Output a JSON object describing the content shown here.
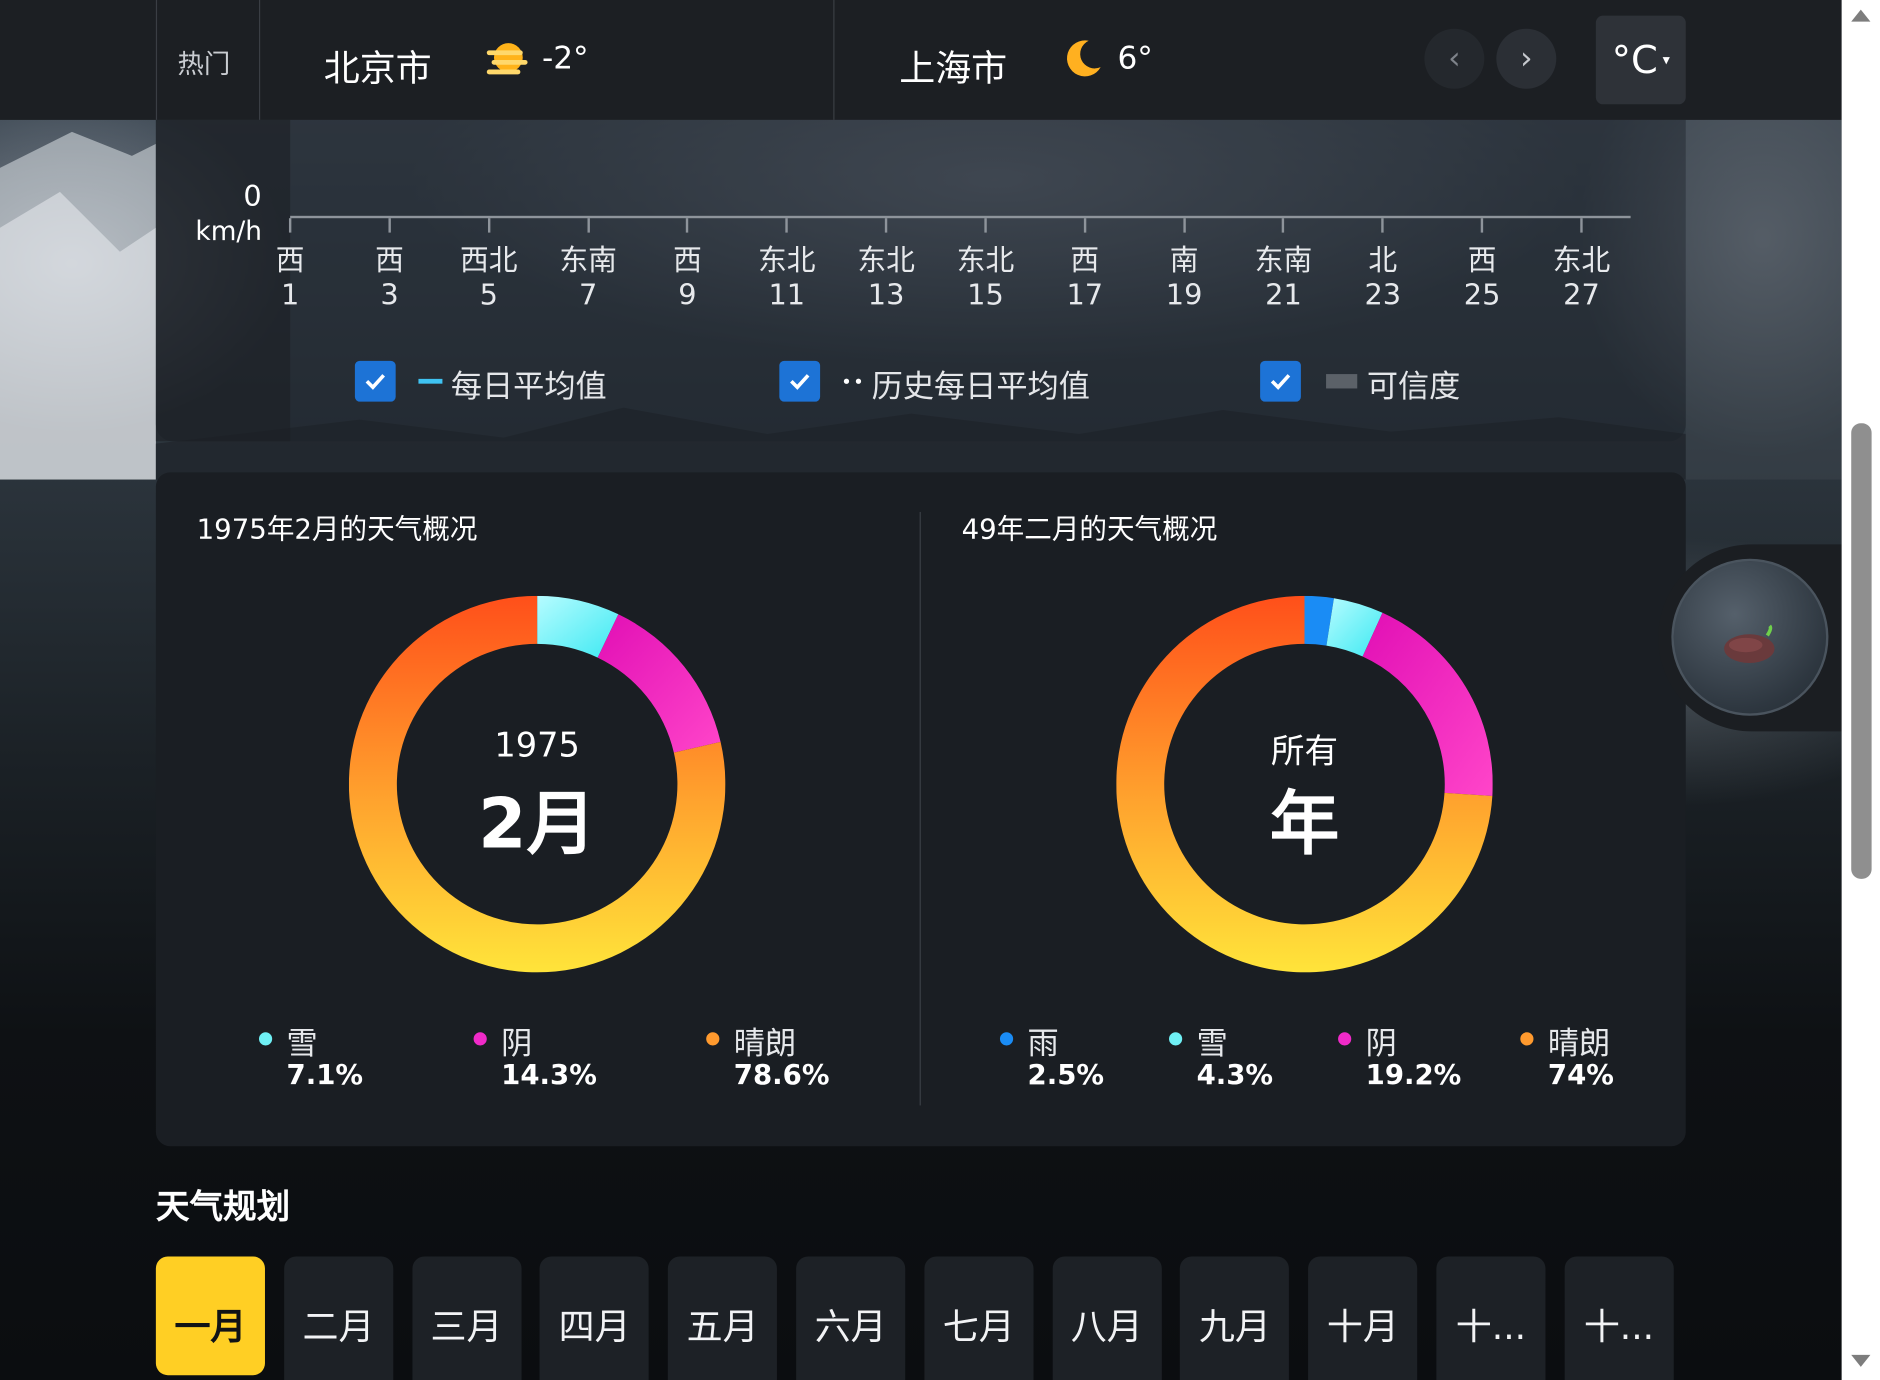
{
  "topbar": {
    "hot_label": "热门",
    "cities": [
      {
        "name": "北京市",
        "temp": "-2°",
        "icon": "hazy-sun-icon"
      },
      {
        "name": "上海市",
        "temp": "6°",
        "icon": "crescent-moon-icon"
      }
    ],
    "prev_label": "‹",
    "next_label": "›",
    "unit_label": "°C",
    "unit_caret": "▾"
  },
  "wind_chart": {
    "zero_label": "0",
    "unit_label": "km/h",
    "ticks": [
      {
        "dir": "西",
        "day": "1"
      },
      {
        "dir": "西",
        "day": "3"
      },
      {
        "dir": "西北",
        "day": "5"
      },
      {
        "dir": "东南",
        "day": "7"
      },
      {
        "dir": "西",
        "day": "9"
      },
      {
        "dir": "东北",
        "day": "11"
      },
      {
        "dir": "东北",
        "day": "13"
      },
      {
        "dir": "东北",
        "day": "15"
      },
      {
        "dir": "西",
        "day": "17"
      },
      {
        "dir": "南",
        "day": "19"
      },
      {
        "dir": "东南",
        "day": "21"
      },
      {
        "dir": "北",
        "day": "23"
      },
      {
        "dir": "西",
        "day": "25"
      },
      {
        "dir": "东北",
        "day": "27"
      }
    ],
    "legend": [
      {
        "label": "每日平均值",
        "checked": true,
        "color": "#3fc3f2"
      },
      {
        "label": "历史每日平均值",
        "checked": true,
        "color": "#ffffff"
      },
      {
        "label": "可信度",
        "checked": true,
        "color": "#5b6168"
      }
    ]
  },
  "overview": {
    "left": {
      "title": "1975年2月的天气概况",
      "center_small": "1975",
      "center_large": "2月",
      "legend": [
        {
          "name": "雪",
          "pct": "7.1%",
          "color": "#6ff0f5"
        },
        {
          "name": "阴",
          "pct": "14.3%",
          "color": "#f02ac8"
        },
        {
          "name": "晴朗",
          "pct": "78.6%",
          "color": "#ff9a2e"
        }
      ]
    },
    "right": {
      "title": "49年二月的天气概况",
      "center_small": "所有",
      "center_large": "年",
      "legend": [
        {
          "name": "雨",
          "pct": "2.5%",
          "color": "#1a8cf5"
        },
        {
          "name": "雪",
          "pct": "4.3%",
          "color": "#6ff0f5"
        },
        {
          "name": "阴",
          "pct": "19.2%",
          "color": "#f02ac8"
        },
        {
          "name": "晴朗",
          "pct": "74%",
          "color": "#ff9a2e"
        }
      ]
    }
  },
  "planning": {
    "title": "天气规划",
    "months": [
      "一月",
      "二月",
      "三月",
      "四月",
      "五月",
      "六月",
      "七月",
      "八月",
      "九月",
      "十月",
      "十...",
      "十..."
    ],
    "active_index": 0
  },
  "colors": {
    "accent_yellow": "#ffcf24",
    "checkbox_blue": "#1d73d6",
    "card_bg": "#1a1e23"
  }
}
